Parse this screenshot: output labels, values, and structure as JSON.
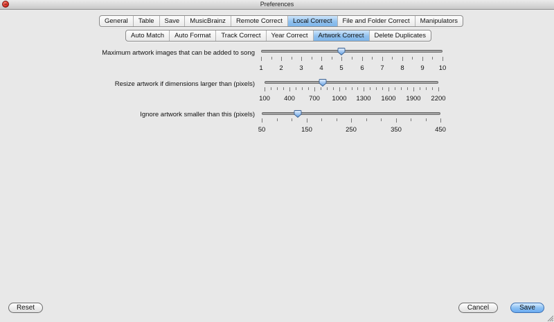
{
  "window": {
    "title": "Preferences"
  },
  "tabs": [
    {
      "label": "General",
      "active": false
    },
    {
      "label": "Table",
      "active": false
    },
    {
      "label": "Save",
      "active": false
    },
    {
      "label": "MusicBrainz",
      "active": false
    },
    {
      "label": "Remote Correct",
      "active": false
    },
    {
      "label": "Local Correct",
      "active": true
    },
    {
      "label": "File and Folder Correct",
      "active": false
    },
    {
      "label": "Manipulators",
      "active": false
    }
  ],
  "subtabs": [
    {
      "label": "Auto Match",
      "active": false
    },
    {
      "label": "Auto Format",
      "active": false
    },
    {
      "label": "Track Correct",
      "active": false
    },
    {
      "label": "Year Correct",
      "active": false
    },
    {
      "label": "Artwork Correct",
      "active": true
    },
    {
      "label": "Delete Duplicates",
      "active": false
    }
  ],
  "sliders": [
    {
      "label": "Maximum artwork images that can be added to song",
      "min": 1,
      "max": 10,
      "value": 5,
      "ticks": [
        "1",
        "2",
        "3",
        "4",
        "5",
        "6",
        "7",
        "8",
        "9",
        "10"
      ],
      "minor_per_major": 1
    },
    {
      "label": "Resize artwork if dimensions larger than (pixels)",
      "min": 100,
      "max": 2200,
      "value": 800,
      "ticks": [
        "100",
        "400",
        "700",
        "1000",
        "1300",
        "1600",
        "1900",
        "2200"
      ],
      "minor_per_major": 3
    },
    {
      "label": "Ignore artwork smaller than this (pixels)",
      "min": 50,
      "max": 450,
      "value": 130,
      "ticks": [
        "50",
        "150",
        "250",
        "350",
        "450"
      ],
      "minor_per_major": 2
    }
  ],
  "buttons": {
    "reset": "Reset",
    "cancel": "Cancel",
    "save": "Save"
  },
  "colors": {
    "active_tab": "#8fc0ee",
    "default_button": "#8cc1f3",
    "window_bg": "#e8e8e8"
  }
}
